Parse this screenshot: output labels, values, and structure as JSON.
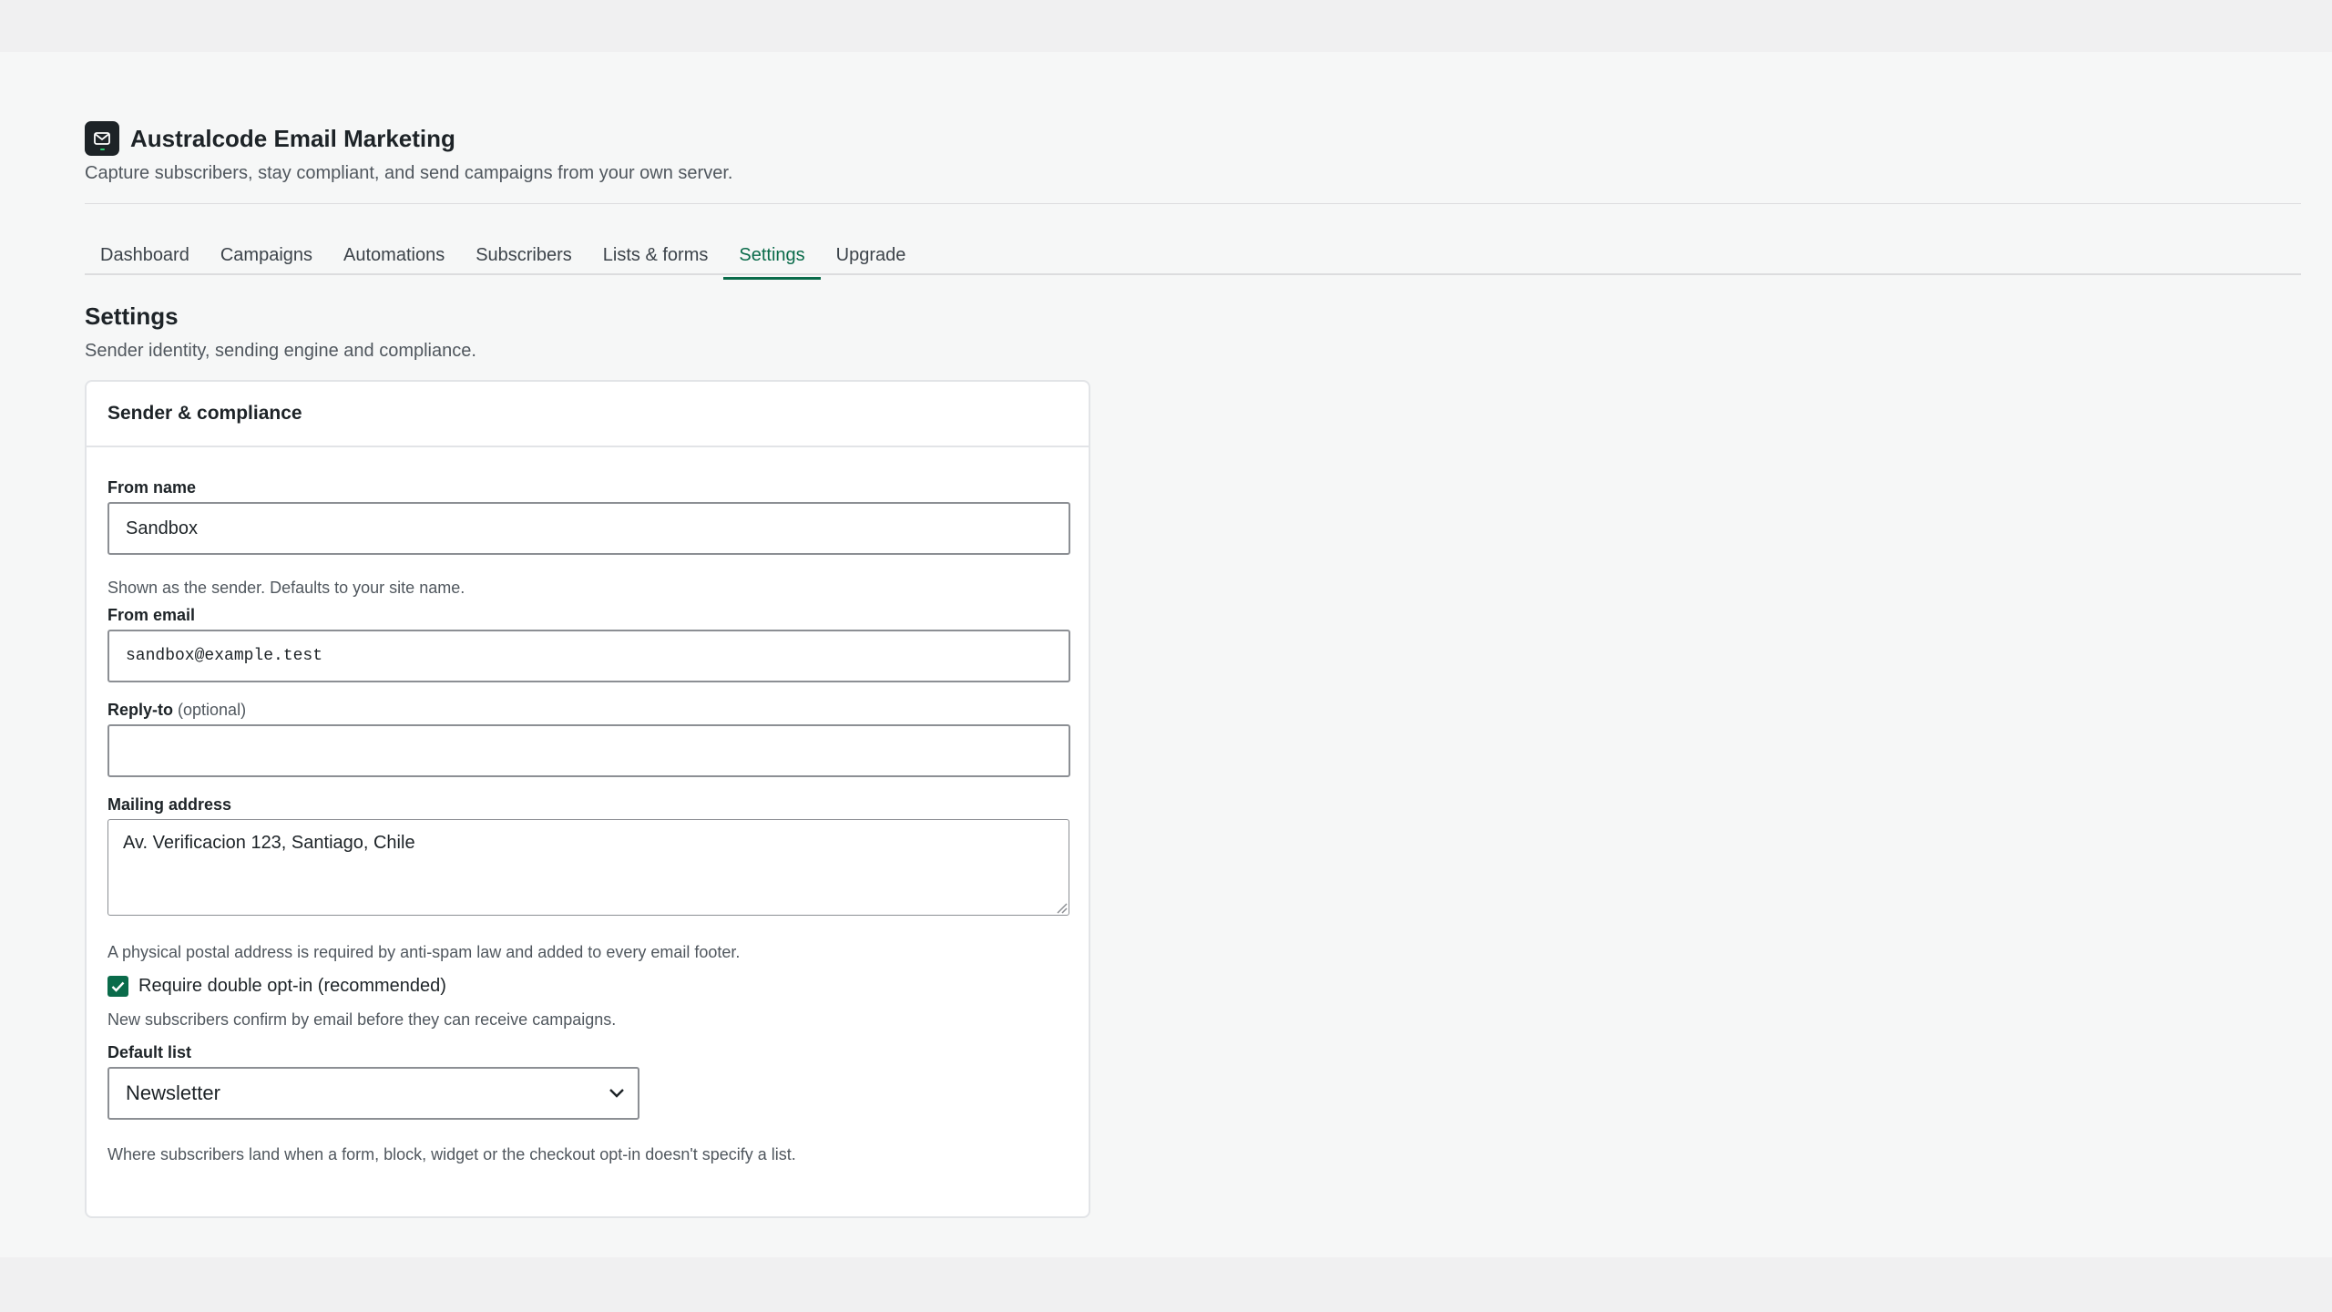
{
  "app": {
    "title": "Australcode Email Marketing",
    "tagline": "Capture subscribers, stay compliant, and send campaigns from your own server.",
    "logo_icon": "mail-icon"
  },
  "tabs": [
    {
      "label": "Dashboard",
      "active": false
    },
    {
      "label": "Campaigns",
      "active": false
    },
    {
      "label": "Automations",
      "active": false
    },
    {
      "label": "Subscribers",
      "active": false
    },
    {
      "label": "Lists & forms",
      "active": false
    },
    {
      "label": "Settings",
      "active": true
    },
    {
      "label": "Upgrade",
      "active": false
    }
  ],
  "page": {
    "title": "Settings",
    "subtitle": "Sender identity, sending engine and compliance."
  },
  "card": {
    "title": "Sender & compliance",
    "from_name": {
      "label": "From name",
      "value": "Sandbox",
      "help": "Shown as the sender. Defaults to your site name."
    },
    "from_email": {
      "label": "From email",
      "value": "sandbox@example.test"
    },
    "reply_to": {
      "label": "Reply-to",
      "optional": "(optional)",
      "value": ""
    },
    "mailing_address": {
      "label": "Mailing address",
      "value": "Av. Verificacion 123, Santiago, Chile",
      "help": "A physical postal address is required by anti-spam law and added to every email footer."
    },
    "double_optin": {
      "label": "Require double opt-in (recommended)",
      "checked": true,
      "help": "New subscribers confirm by email before they can receive campaigns."
    },
    "default_list": {
      "label": "Default list",
      "value": "Newsletter",
      "help": "Where subscribers land when a form, block, widget or the checkout opt-in doesn't specify a list."
    }
  },
  "colors": {
    "accent": "#0a6b4a",
    "text": "#1d2327",
    "muted": "#50575e",
    "border": "#8c8f94"
  }
}
